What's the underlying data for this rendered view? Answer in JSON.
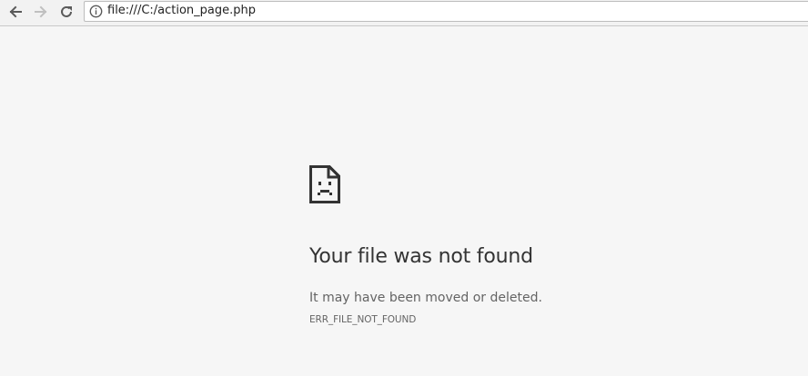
{
  "toolbar": {
    "back_icon": "arrow-left-icon",
    "forward_icon": "arrow-right-icon",
    "reload_icon": "reload-icon",
    "forward_enabled": false
  },
  "omnibox": {
    "security_icon": "info-icon",
    "url": "file:///C:/action_page.php"
  },
  "error_page": {
    "icon": "sad-file-icon",
    "heading": "Your file was not found",
    "description": "It may have been moved or deleted.",
    "error_code": "ERR_FILE_NOT_FOUND"
  },
  "colors": {
    "page_background": "#f6f6f6",
    "toolbar_background": "#f2f2f2",
    "heading_text": "#333333",
    "secondary_text": "#646464",
    "icon_dark": "#5a5a5a",
    "icon_disabled": "#c0c0c0"
  }
}
